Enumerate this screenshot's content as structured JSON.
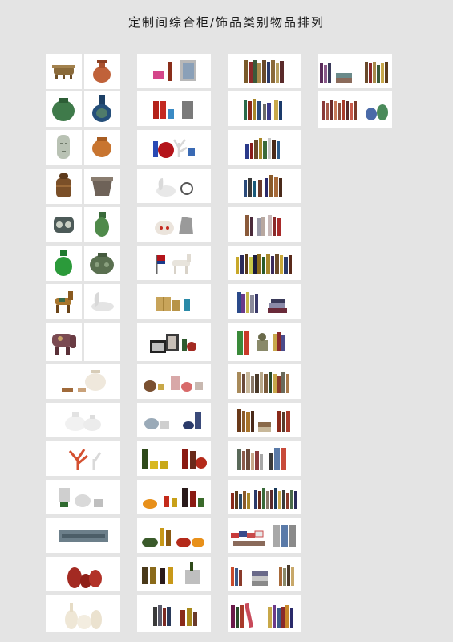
{
  "title": "定制间综合柜/饰品类别物品排列",
  "columns": [
    {
      "name": "ceramics-column",
      "tiles": [
        "bronze-tripod-vessel",
        "terracotta-pot",
        "green-vase",
        "blue-porcelain-vase",
        "jade-face-sculpture",
        "orange-pot",
        "carved-wooden-jar",
        "ornate-bowl-pot",
        "painted-jar",
        "green-carved-vase",
        "green-vase-tall",
        "green-round-pot",
        "tang-horse",
        "swan-figurine",
        "painted-elephant",
        "empty-tile"
      ]
    },
    {
      "name": "ceramics-wide-column",
      "tiles": [
        "white-teapot-set",
        "white-lidded-jars",
        "red-coral-branches",
        "silver-teapot-set",
        "carved-panel",
        "red-vases",
        " white-vases"
      ]
    },
    {
      "name": "ornaments-column",
      "tiles": [
        "bottles-and-photo-frame",
        "soda-bottles-and-cup",
        "globe-and-coral",
        "swan-and-clock",
        "teapot-and-iron",
        "flags-and-horse",
        "gift-boxes",
        "photo-frame-and-bottles",
        "baskets-and-jars",
        "teapot-and-lamps",
        "wine-bottles-and-cups",
        "fruit-bowl-and-wine",
        "food-bowls-and-bottles",
        "wine-bottles-and-bucket",
        "books-and-bottles"
      ]
    },
    {
      "name": "books-column",
      "tiles": [
        "books-set-1",
        "books-set-2",
        "books-set-3",
        "books-set-4",
        "books-set-5",
        "books-set-6",
        "books-set-7",
        "books-and-binders",
        "books-set-8",
        "books-set-9",
        "books-set-10",
        "books-set-11",
        "flags-and-binders",
        "books-and-magazines",
        "books-set-12"
      ]
    },
    {
      "name": "extra-column",
      "tiles": [
        "books-and-magazines-small",
        "books-and-vases"
      ]
    }
  ],
  "colors": {
    "background": "#e4e4e4",
    "tile": "#ffffff",
    "title": "#1a1a1a"
  }
}
